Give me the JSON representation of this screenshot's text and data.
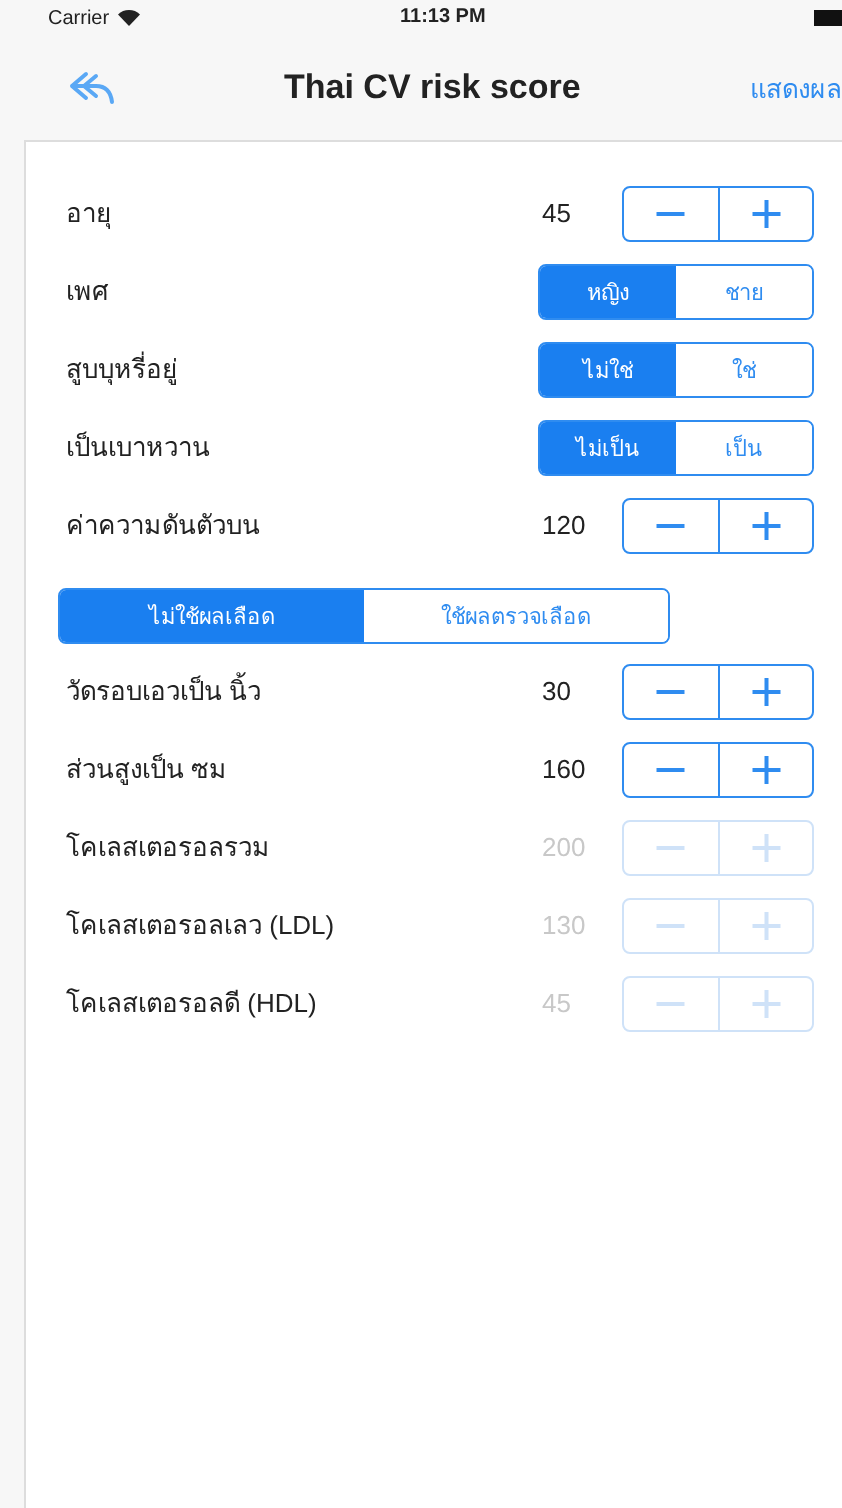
{
  "status_bar": {
    "carrier": "Carrier",
    "time": "11:13 PM"
  },
  "nav": {
    "title": "Thai CV risk score",
    "action": "แสดงผล"
  },
  "rows": [
    {
      "kind": "stepper",
      "label": "อายุ",
      "value": "45",
      "disabled": false
    },
    {
      "kind": "segment",
      "label": "เพศ",
      "options": [
        {
          "label": "หญิง",
          "selected": true
        },
        {
          "label": "ชาย",
          "selected": false
        }
      ]
    },
    {
      "kind": "segment",
      "label": "สูบบุหรี่อยู่",
      "options": [
        {
          "label": "ไม่ใช่",
          "selected": true
        },
        {
          "label": "ใช่",
          "selected": false
        }
      ]
    },
    {
      "kind": "segment",
      "label": "เป็นเบาหวาน",
      "options": [
        {
          "label": "ไม่เป็น",
          "selected": true
        },
        {
          "label": "เป็น",
          "selected": false
        }
      ]
    },
    {
      "kind": "stepper",
      "label": "ค่าความดันตัวบน",
      "value": "120",
      "disabled": false
    }
  ],
  "blood_mode": [
    {
      "label": "ไม่ใช้ผลเลือด",
      "selected": true
    },
    {
      "label": "ใช้ผลตรวจเลือด",
      "selected": false
    }
  ],
  "blood_rows": [
    {
      "kind": "stepper",
      "label": "วัดรอบเอวเป็น นิ้ว",
      "value": "30",
      "disabled": false
    },
    {
      "kind": "stepper",
      "label": "ส่วนสูงเป็น ซม",
      "value": "160",
      "disabled": false
    },
    {
      "kind": "stepper",
      "label": "โคเลสเตอรอลรวม",
      "value": "200",
      "disabled": true
    },
    {
      "kind": "stepper",
      "label": "โคเลสเตอรอลเลว (LDL)",
      "value": "130",
      "disabled": true
    },
    {
      "kind": "stepper",
      "label": "โคเลสเตอรอลดี (HDL)",
      "value": "45",
      "disabled": true
    }
  ]
}
